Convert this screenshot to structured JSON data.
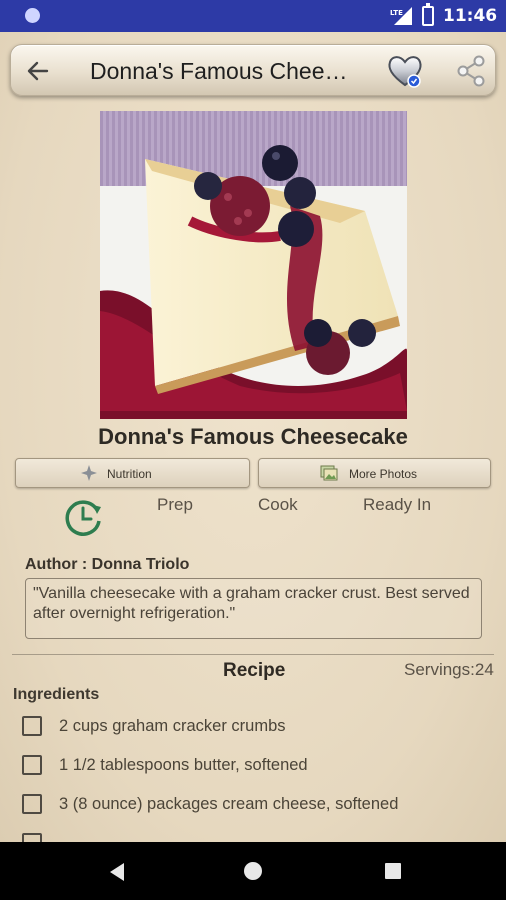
{
  "status_bar": {
    "time": "11:46",
    "network": "LTE",
    "icons": [
      "notification-dot-icon",
      "lte-signal-icon",
      "battery-icon"
    ]
  },
  "toolbar": {
    "title": "Donna's Famous Chee…",
    "back_icon": "arrow-left-icon",
    "favorite_icon": "heart-icon",
    "share_icon": "share-icon"
  },
  "recipe": {
    "title": "Donna's Famous Cheesecake",
    "image_alt_icon": "cheesecake-photo"
  },
  "buttons": {
    "nutrition": "Nutrition",
    "more_photos": "More Photos"
  },
  "times": {
    "prep_label": "Prep",
    "cook_label": "Cook",
    "ready_label": "Ready In",
    "icon": "clock-refresh-icon"
  },
  "author": "Author : Donna Triolo",
  "description": "\"Vanilla cheesecake with a graham cracker crust.  Best served after overnight refrigeration.\"",
  "section": {
    "recipe_heading": "Recipe",
    "servings": "Servings:24",
    "ingredients_heading": "Ingredients"
  },
  "ingredients": [
    {
      "text": "2 cups graham cracker crumbs",
      "checked": false
    },
    {
      "text": "1 1/2 tablespoons butter, softened",
      "checked": false
    },
    {
      "text": "3 (8 ounce) packages cream cheese, softened",
      "checked": false
    }
  ],
  "colors": {
    "status_bar": "#2d3aa6",
    "paper": "#e9dcc5",
    "clock_icon": "#2e7d4f"
  },
  "nav_bar": {
    "icons": [
      "nav-back-icon",
      "nav-home-icon",
      "nav-recents-icon"
    ]
  }
}
